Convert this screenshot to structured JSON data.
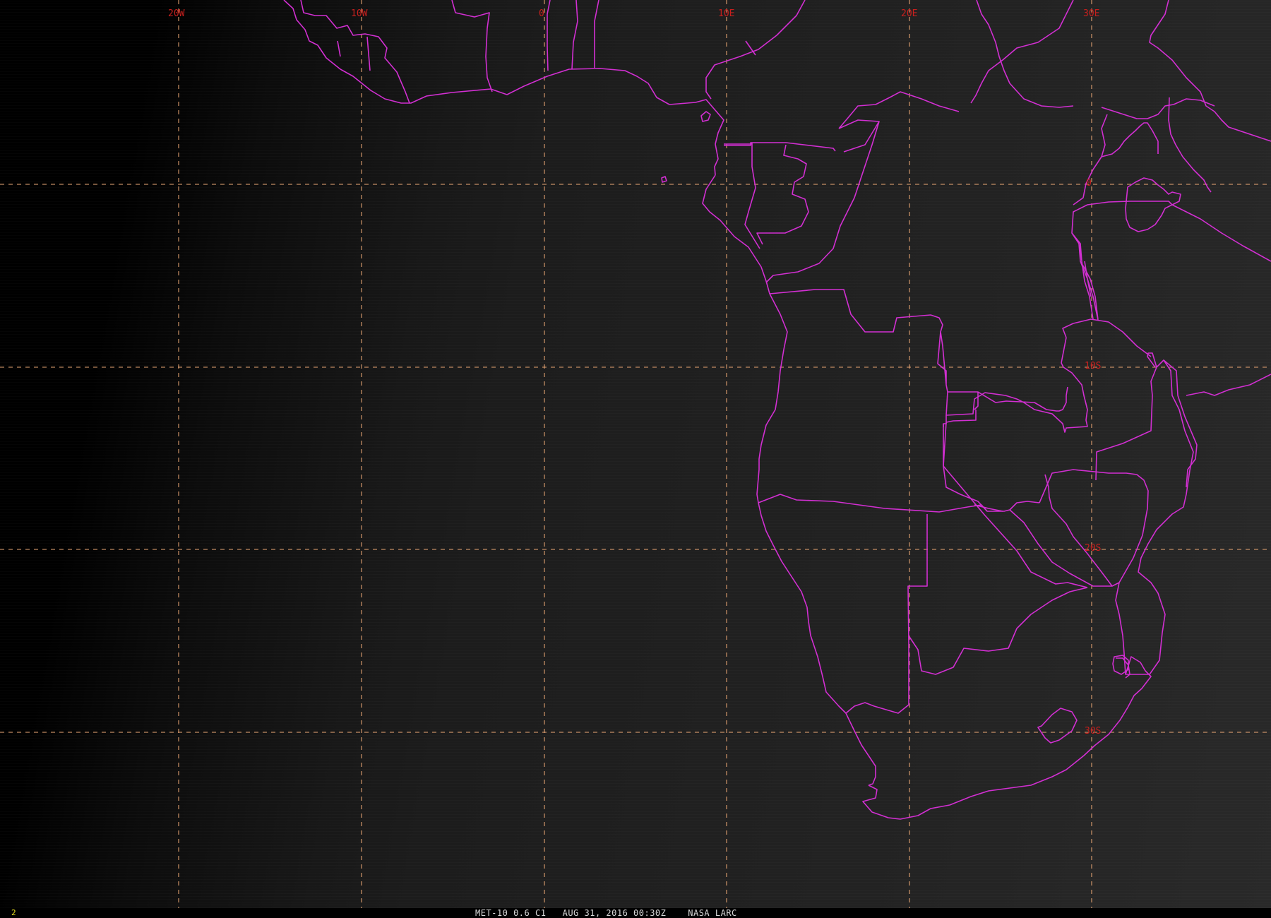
{
  "status": {
    "frame_number": "2",
    "caption": "MET-10 0.6 C1   AUG 31, 2016 00:30Z    NASA LARC"
  },
  "grid_labels": {
    "lon_20w": "20W",
    "lon_10w": "10W",
    "lon_0": "0",
    "lon_10e": "10E",
    "lon_20e": "20E",
    "lon_30e": "30E",
    "lat_0": "0",
    "lat_10s": "10S",
    "lat_20s": "20S",
    "lat_30s": "30S"
  },
  "colors": {
    "borders": "#d22fd2",
    "grid_lines": "#e0a070",
    "grid_labels": "#c8201e",
    "frame_number": "#e8e020"
  }
}
